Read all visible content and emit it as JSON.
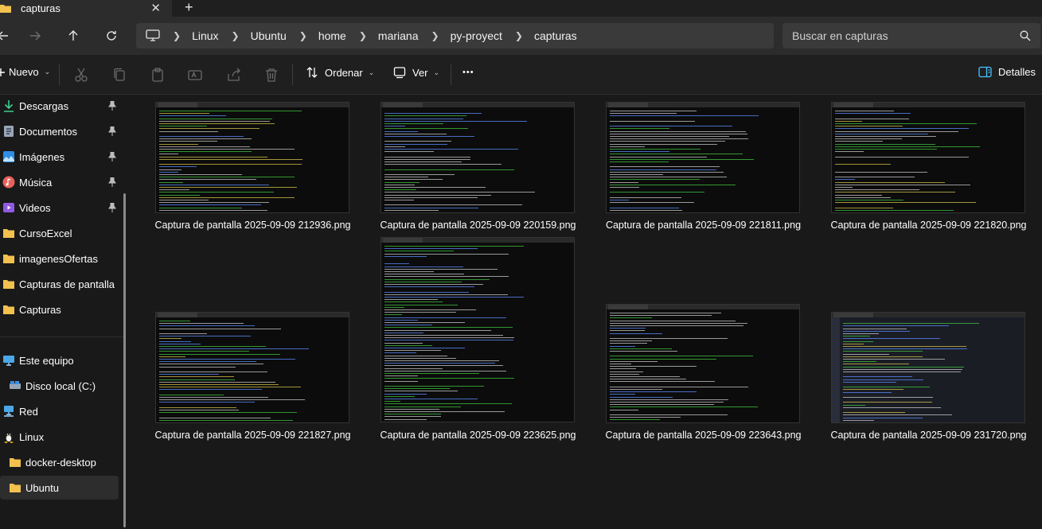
{
  "tab": {
    "title": "capturas",
    "close": "✕",
    "new": "+"
  },
  "breadcrumb": [
    "Linux",
    "Ubuntu",
    "home",
    "mariana",
    "py-proyect",
    "capturas"
  ],
  "search": {
    "placeholder": "Buscar en capturas"
  },
  "toolbar": {
    "new_label": "Nuevo",
    "sort_label": "Ordenar",
    "view_label": "Ver",
    "more_label": "•••",
    "details_label": "Detalles"
  },
  "sidebar": {
    "quick": [
      {
        "label": "Descargas",
        "icon": "download-icon",
        "pinned": true
      },
      {
        "label": "Documentos",
        "icon": "documents-icon",
        "pinned": true
      },
      {
        "label": "Imágenes",
        "icon": "pictures-icon",
        "pinned": true
      },
      {
        "label": "Música",
        "icon": "music-icon",
        "pinned": true
      },
      {
        "label": "Videos",
        "icon": "videos-icon",
        "pinned": true
      },
      {
        "label": "CursoExcel",
        "icon": "folder-icon",
        "pinned": false
      },
      {
        "label": "imagenesOfertas",
        "icon": "folder-icon",
        "pinned": false
      },
      {
        "label": "Capturas de pantalla",
        "icon": "folder-icon",
        "pinned": false
      },
      {
        "label": "Capturas",
        "icon": "folder-icon",
        "pinned": false
      }
    ],
    "locations": [
      {
        "label": "Este equipo",
        "icon": "this-pc-icon"
      },
      {
        "label": "Disco local (C:)",
        "icon": "drive-icon"
      },
      {
        "label": "Red",
        "icon": "network-icon"
      },
      {
        "label": "Linux",
        "icon": "linux-icon"
      },
      {
        "label": "docker-desktop",
        "icon": "folder-icon"
      },
      {
        "label": "Ubuntu",
        "icon": "folder-icon",
        "selected": true
      }
    ]
  },
  "files": [
    {
      "name": "Captura de pantalla 2025-09-09 212936.png"
    },
    {
      "name": "Captura de pantalla 2025-09-09 220159.png"
    },
    {
      "name": "Captura de pantalla 2025-09-09 221811.png"
    },
    {
      "name": "Captura de pantalla 2025-09-09 221820.png"
    },
    {
      "name": "Captura de pantalla 2025-09-09 221827.png"
    },
    {
      "name": "Captura de pantalla 2025-09-09 223625.png"
    },
    {
      "name": "Captura de pantalla 2025-09-09 223643.png"
    },
    {
      "name": "Captura de pantalla 2025-09-09 231720.png"
    }
  ],
  "colors": {
    "accent": "#4cc2ff",
    "folder": "#f2c14e",
    "terminal_green": "#3fc43f",
    "terminal_blue": "#5b8cff"
  }
}
